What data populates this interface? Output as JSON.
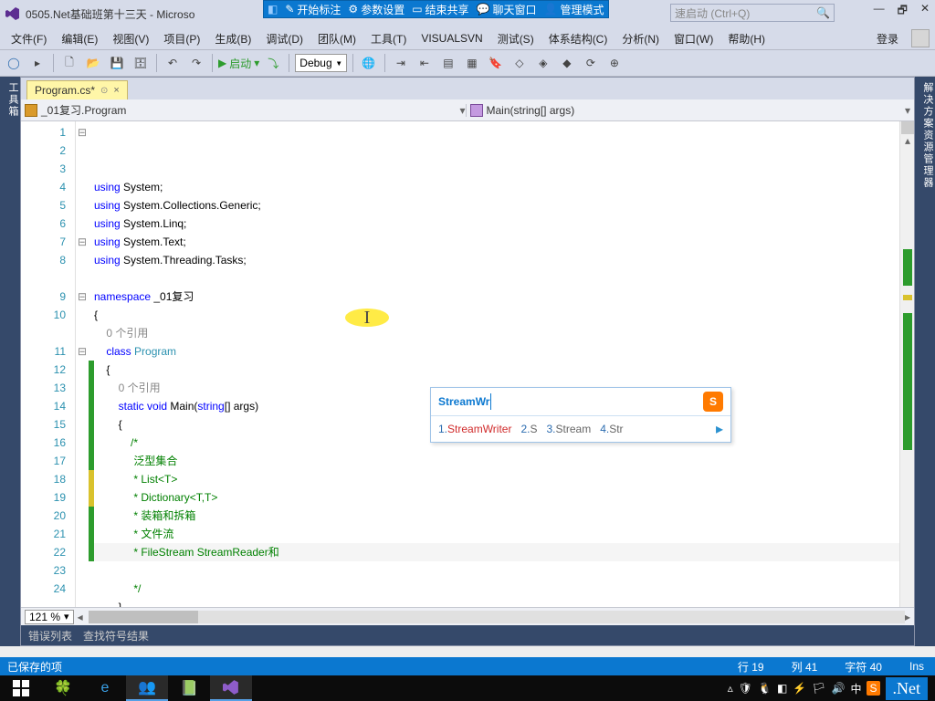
{
  "title": "0505.Net基础班第十三天 - Microso",
  "share": {
    "start": "开始标注",
    "param": "参数设置",
    "end": "结束共享",
    "chat": "聊天窗口",
    "mgr": "管理模式"
  },
  "quick_launch": "速启动 (Ctrl+Q)",
  "menu": {
    "file": "文件(F)",
    "edit": "编辑(E)",
    "view": "视图(V)",
    "project": "项目(P)",
    "build": "生成(B)",
    "debug": "调试(D)",
    "team": "团队(M)",
    "tools": "工具(T)",
    "svn": "VISUALSVN",
    "test": "测试(S)",
    "arch": "体系结构(C)",
    "analyze": "分析(N)",
    "window": "窗口(W)",
    "help": "帮助(H)",
    "login": "登录"
  },
  "toolbar": {
    "run": "启动",
    "config": "Debug"
  },
  "tool_strip_left": "工具箱",
  "tool_strip_right": "解决方案资源管理器",
  "tab": {
    "name": "Program.cs*",
    "pin": "📌",
    "close": "×"
  },
  "nav": {
    "left": "_01复习.Program",
    "right": "Main(string[] args)"
  },
  "lines": [
    {
      "n": "1",
      "fold": "⊟",
      "chg": "",
      "code": "<span class='kw'>using</span> System;"
    },
    {
      "n": "2",
      "fold": "",
      "chg": "",
      "code": "<span class='kw'>using</span> System.Collections.Generic;"
    },
    {
      "n": "3",
      "fold": "",
      "chg": "",
      "code": "<span class='kw'>using</span> System.Linq;"
    },
    {
      "n": "4",
      "fold": "",
      "chg": "",
      "code": "<span class='kw'>using</span> System.Text;"
    },
    {
      "n": "5",
      "fold": "",
      "chg": "",
      "code": "<span class='kw'>using</span> System.Threading.Tasks;"
    },
    {
      "n": "6",
      "fold": "",
      "chg": "",
      "code": ""
    },
    {
      "n": "7",
      "fold": "⊟",
      "chg": "",
      "code": "<span class='kw'>namespace</span> _01复习"
    },
    {
      "n": "8",
      "fold": "",
      "chg": "",
      "code": "{"
    },
    {
      "n": "",
      "fold": "",
      "chg": "",
      "code": "    <span class='ref'>0 个引用</span>"
    },
    {
      "n": "9",
      "fold": "⊟",
      "chg": "",
      "code": "    <span class='kw'>class</span> <span class='tp'>Program</span>"
    },
    {
      "n": "10",
      "fold": "",
      "chg": "",
      "code": "    {"
    },
    {
      "n": "",
      "fold": "",
      "chg": "",
      "code": "        <span class='ref'>0 个引用</span>"
    },
    {
      "n": "11",
      "fold": "⊟",
      "chg": "",
      "code": "        <span class='kw'>static</span> <span class='kw'>void</span> Main(<span class='kw'>string</span>[] args)"
    },
    {
      "n": "12",
      "fold": "",
      "chg": "chg-g",
      "code": "        {"
    },
    {
      "n": "13",
      "fold": "",
      "chg": "chg-g",
      "code": "            <span class='cm'>/*</span>"
    },
    {
      "n": "14",
      "fold": "",
      "chg": "chg-g",
      "code": "             <span class='cm'>泛型集合</span>"
    },
    {
      "n": "15",
      "fold": "",
      "chg": "chg-g",
      "code": "             <span class='cm'>* List&lt;T&gt;</span>"
    },
    {
      "n": "16",
      "fold": "",
      "chg": "chg-g",
      "code": "             <span class='cm'>* Dictionary&lt;T,T&gt;</span>"
    },
    {
      "n": "17",
      "fold": "",
      "chg": "chg-g",
      "code": "             <span class='cm'>* 装箱和拆箱</span>"
    },
    {
      "n": "18",
      "fold": "",
      "chg": "chg-y",
      "code": "             <span class='cm'>* 文件流</span>"
    },
    {
      "n": "19",
      "fold": "",
      "chg": "chg-y",
      "code": "             <span class='cm'>* FileStream StreamReader和</span>",
      "cur": true
    },
    {
      "n": "20",
      "fold": "",
      "chg": "chg-g",
      "code": ""
    },
    {
      "n": "21",
      "fold": "",
      "chg": "chg-g",
      "code": "             <span class='cm'>*/</span>"
    },
    {
      "n": "22",
      "fold": "",
      "chg": "chg-g",
      "code": "        }"
    },
    {
      "n": "23",
      "fold": "",
      "chg": "",
      "code": "    }"
    },
    {
      "n": "24",
      "fold": "",
      "chg": "",
      "code": "}"
    }
  ],
  "zoom": "121 %",
  "bottom_tabs": {
    "err": "错误列表",
    "sym": "查找符号结果"
  },
  "status": {
    "saved": "已保存的项",
    "line": "行 19",
    "col": "列 41",
    "char": "字符 40",
    "ins": "Ins"
  },
  "ime": {
    "input": "StreamWr",
    "c1": "StreamWriter",
    "c2": "S",
    "c3": "Stream",
    "c4": "Str"
  },
  "tray": {
    "net": ".Net"
  }
}
